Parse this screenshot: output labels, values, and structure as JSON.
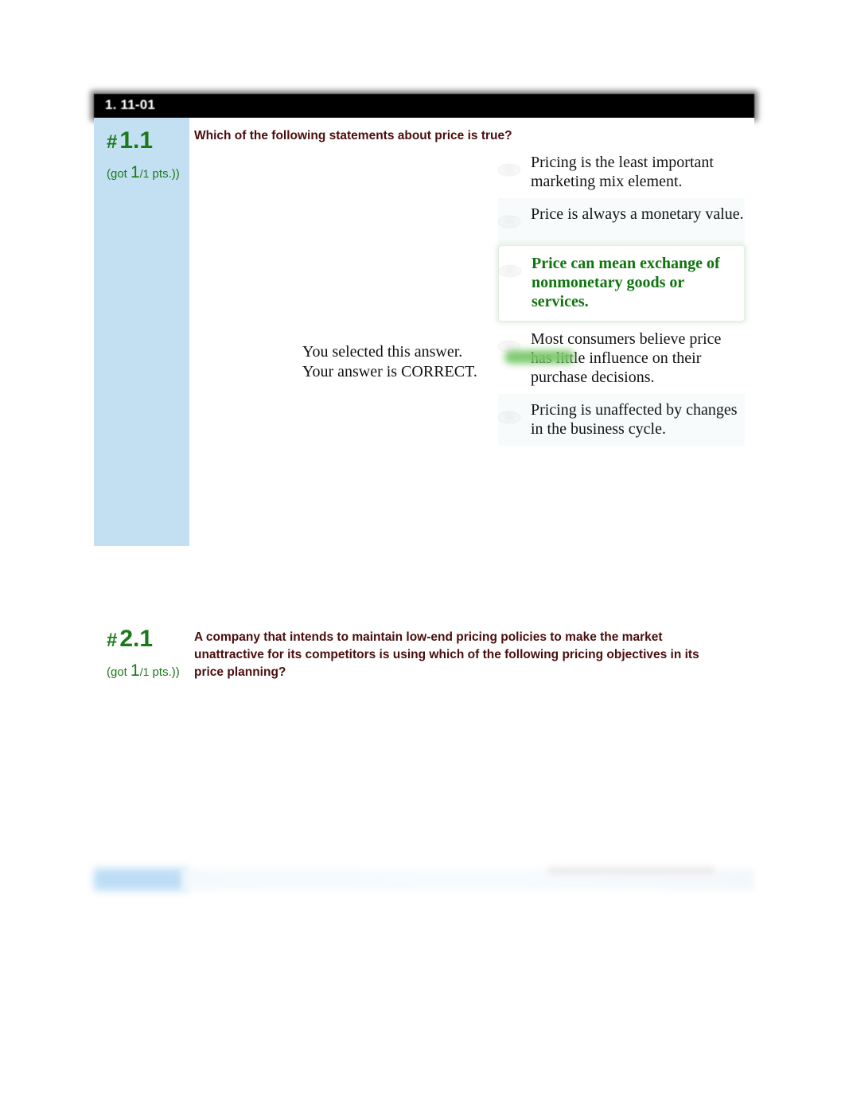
{
  "header": {
    "title": "1. 11-01"
  },
  "question1": {
    "number_hash": "#",
    "number": "1.1",
    "points_prefix": "(got ",
    "points_earned": "1",
    "points_possible": "/1",
    "points_suffix": " pts.))",
    "prompt": "Which of the following statements about price is true?",
    "feedback_line1": "You selected this answer.",
    "feedback_line2": "Your answer is CORRECT.",
    "options": [
      {
        "text": "Pricing is the least important marketing mix element.",
        "state": "unselected"
      },
      {
        "text": "Price is always a monetary value.",
        "state": "unselected"
      },
      {
        "text": "Price can mean exchange of nonmonetary goods or services.",
        "state": "correct"
      },
      {
        "text": "Most consumers believe price has little influence on their purchase decisions.",
        "state": "unselected"
      },
      {
        "text": "Pricing is unaffected by changes in the business cycle.",
        "state": "unselected"
      }
    ]
  },
  "question2": {
    "number_hash": "#",
    "number": "2.1",
    "points_prefix": "(got ",
    "points_earned": "1",
    "points_possible": "/1",
    "points_suffix": " pts.))",
    "prompt": "A company that intends to maintain low-end pricing policies to make the market unattractive for its competitors is using which of the following pricing objectives in its price planning?"
  },
  "colors": {
    "sidebar_blue": "#c3e0f2",
    "green_text": "#1a7a1a",
    "correct_green": "#10740f",
    "prompt_maroon": "#4a0d0d",
    "title_bar": "#000000",
    "arrow_green": "#7ac76a"
  }
}
